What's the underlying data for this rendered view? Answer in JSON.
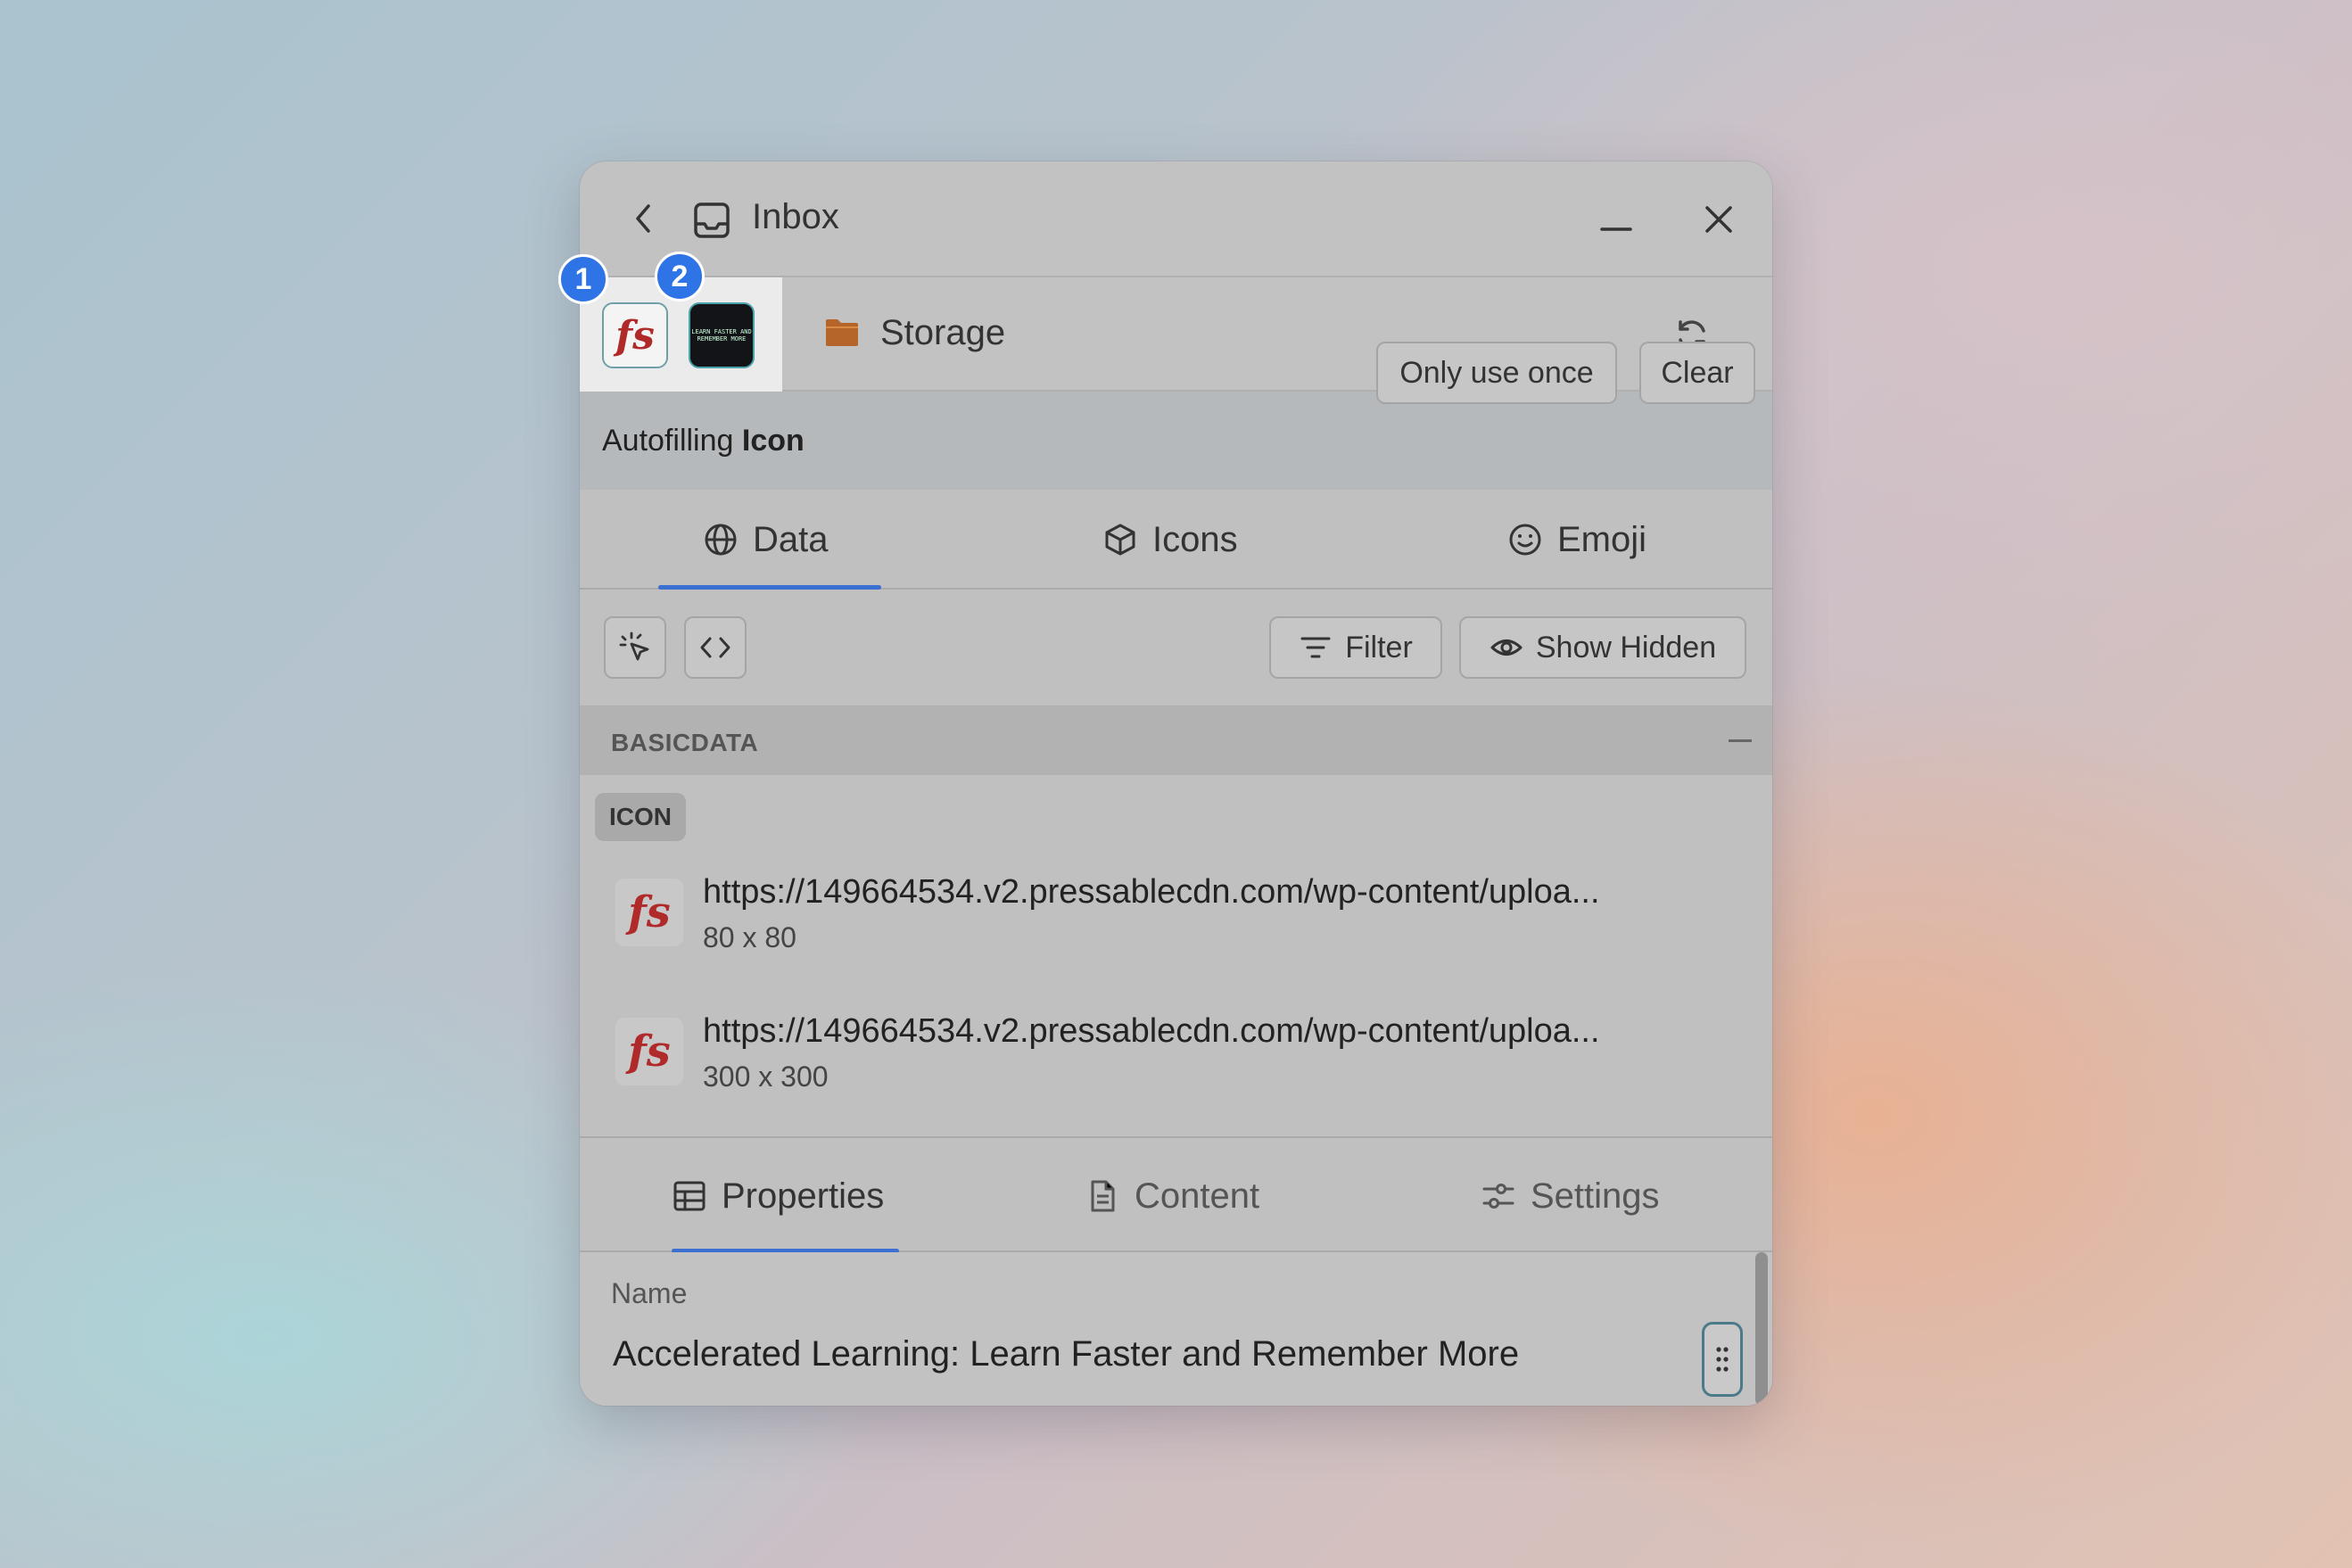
{
  "header": {
    "back_icon": "chevron-left-icon",
    "inbox_icon": "inbox-icon",
    "title": "Inbox",
    "minimize_icon": "minimize-icon",
    "close_icon": "close-icon"
  },
  "toolbar": {
    "tabs": [
      {
        "badge": "1",
        "logo_text": "fs"
      },
      {
        "badge": "2",
        "thumb_text": "LEARN FASTER AND REMEMBER MORE"
      }
    ],
    "storage_label": "Storage",
    "folder_icon": "folder-icon",
    "refresh_icon": "refresh-icon"
  },
  "autofill": {
    "prefix": "Autofilling",
    "field": "Icon",
    "once_label": "Only use once",
    "clear_label": "Clear"
  },
  "source_tabs": [
    {
      "label": "Data",
      "icon": "globe-icon",
      "active": true
    },
    {
      "label": "Icons",
      "icon": "cube-icon",
      "active": false
    },
    {
      "label": "Emoji",
      "icon": "smiley-icon",
      "active": false
    }
  ],
  "filterbar": {
    "picker_icon": "pointer-sparkle-icon",
    "code_icon": "code-icon",
    "filter_label": "Filter",
    "show_hidden_label": "Show Hidden"
  },
  "section": {
    "title": "BASICDATA",
    "tag": "ICON",
    "items": [
      {
        "url": "https://149664534.v2.pressablecdn.com/wp-content/uploa...",
        "size": "80 x 80",
        "logo_text": "fs"
      },
      {
        "url": "https://149664534.v2.pressablecdn.com/wp-content/uploa...",
        "size": "300 x 300",
        "logo_text": "fs"
      }
    ]
  },
  "bottom_tabs": [
    {
      "label": "Properties",
      "icon": "table-icon",
      "active": true
    },
    {
      "label": "Content",
      "icon": "document-icon",
      "active": false
    },
    {
      "label": "Settings",
      "icon": "sliders-icon",
      "active": false
    }
  ],
  "properties": {
    "name_label": "Name",
    "name_value": "Accelerated Learning: Learn Faster and Remember More",
    "drag_icon": "drag-handle-icon"
  },
  "colors": {
    "accent": "#3b6fd1",
    "badge": "#2f74e6",
    "logo_red": "#b02a2a",
    "folder": "#b5652a"
  }
}
